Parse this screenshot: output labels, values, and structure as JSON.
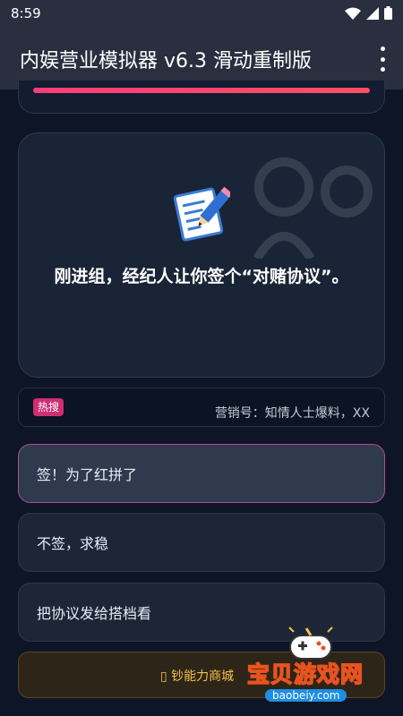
{
  "status_bar": {
    "time": "8:59"
  },
  "app_bar": {
    "title": "内娱营业模拟器 v6.3 滑动重制版",
    "menu_icon": "more-vert-icon"
  },
  "progress": {
    "value": 1.0,
    "color": "#ff4068"
  },
  "scene": {
    "icon": "memo-pencil-icon",
    "text": "刚进组，经纪人让你签个“对赌协议”。"
  },
  "hot_news": {
    "badge": "热搜",
    "text": "营销号：知情人士爆料，XX"
  },
  "choices": [
    {
      "label": "签！为了红拼了",
      "selected": true
    },
    {
      "label": "不签，求稳",
      "selected": false
    },
    {
      "label": "把协议发给搭档看",
      "selected": false
    }
  ],
  "shop": {
    "label": "▯ 钞能力商城"
  },
  "watermark": {
    "text": "宝贝游戏网",
    "url": "baobeiy.com"
  },
  "colors": {
    "background": "#0e1526",
    "accent": "#cf2f73",
    "shop_text": "#f2c247"
  }
}
